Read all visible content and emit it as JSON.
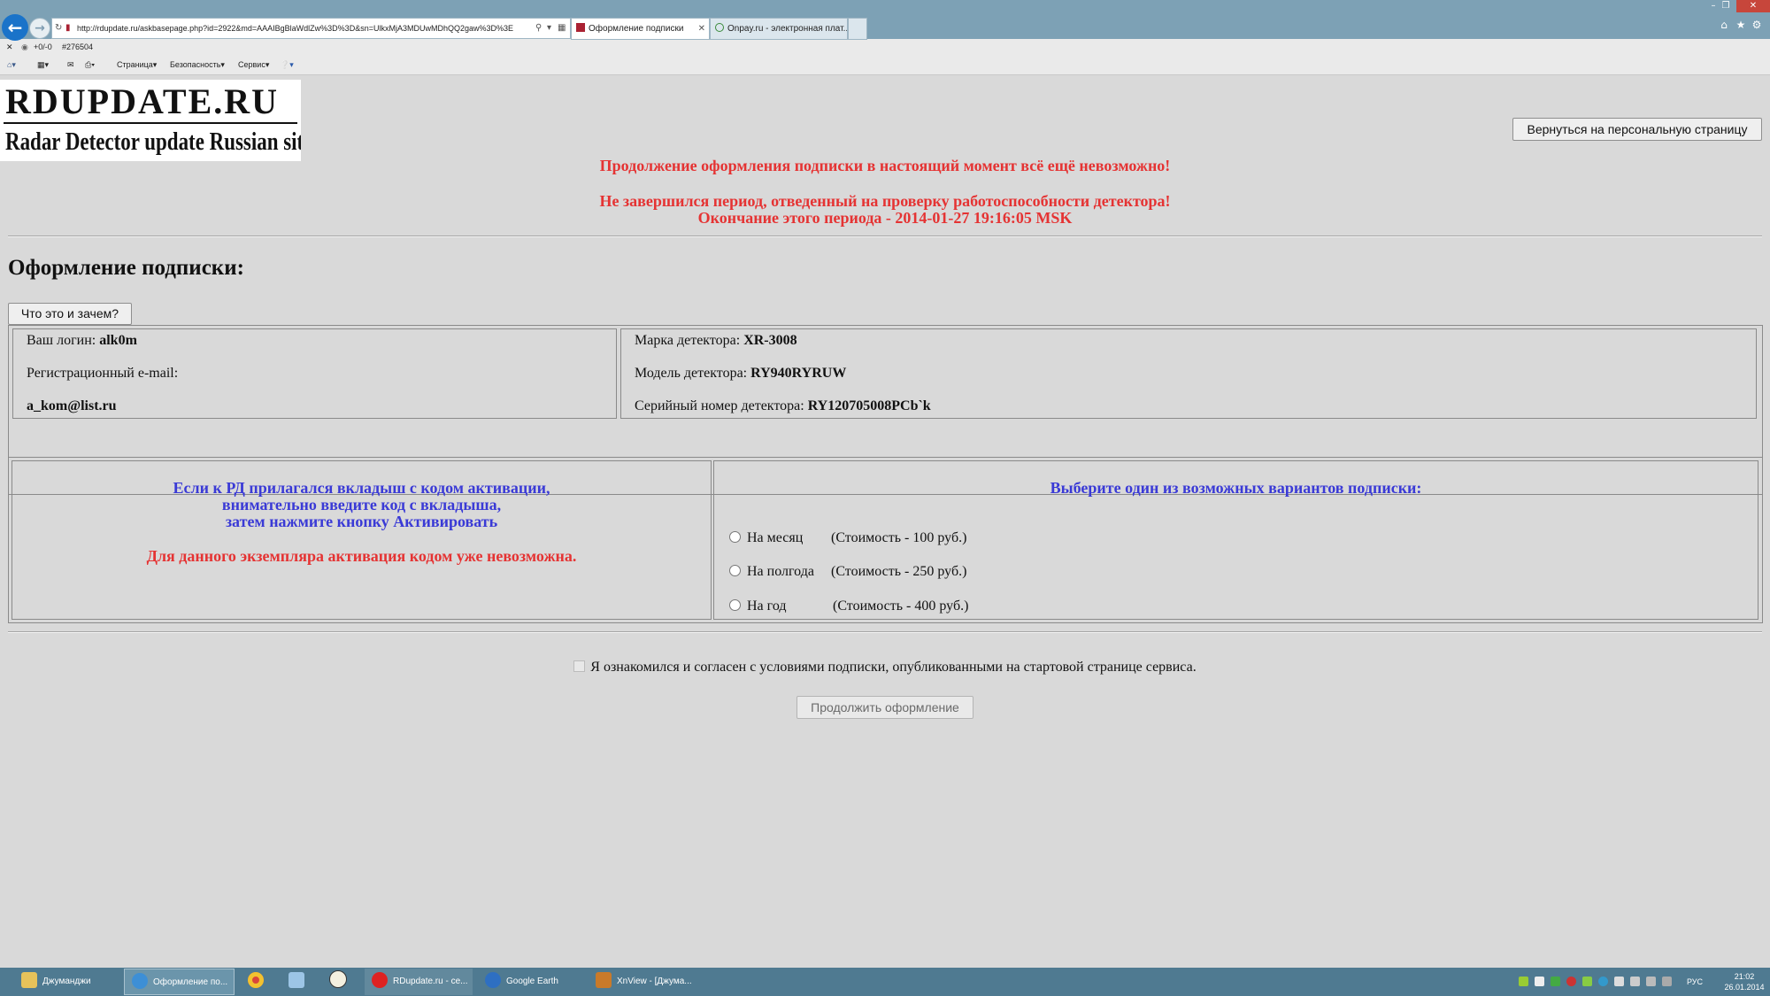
{
  "browser": {
    "address_url": "http://rdupdate.ru/askbasepage.php?id=2922&md=AAAIBgBlaWdlZw%3D%3D&sn=UlkxMjA3MDUwMDhQQ2gaw%3D%3E",
    "tabs": [
      {
        "label": "Оформление подписки",
        "active": true
      },
      {
        "label": "Onpay.ru - электронная плат...",
        "active": false
      }
    ],
    "status_text": "+0/-0",
    "status_id": "#276504",
    "command_bar": [
      "Страница",
      "Безопасность",
      "Сервис"
    ]
  },
  "logo": {
    "line1": "RDUPDATE.RU",
    "line2": "Radar Detector update Russian site"
  },
  "header": {
    "return_button": "Вернуться на персональную страницу",
    "warning1": "Продолжение оформления подписки в настоящий момент всё ещё невозможно!",
    "warning2": "Не завершился период, отведенный на проверку работоспособности детектора!",
    "warning3": "Окончание этого периода - 2014-01-27 19:16:05 MSK"
  },
  "main": {
    "title": "Оформление подписки:",
    "what_button": "Что это и зачем?",
    "user": {
      "login_label": "Ваш логин:",
      "login_value": "alk0m",
      "email_label": "Регистрационный e-mail:",
      "email_value": "a_kom@list.ru"
    },
    "detector": {
      "brand_label": "Марка детектора:",
      "brand_value": "XR-3008",
      "model_label": "Модель детектора:",
      "model_value": "RY940RYRUW",
      "serial_label": "Серийный номер детектора:",
      "serial_value": "RY120705008PCb`k"
    },
    "activation": {
      "line1": "Если к РД прилагался вкладыш с кодом активации,",
      "line2": "внимательно введите код с вкладыша,",
      "line3": "затем нажмите кнопку Активировать",
      "unavailable": "Для данного экземпляра активация кодом уже невозможна."
    },
    "subscription": {
      "heading": "Выберите один из возможных вариантов подписки:",
      "options": [
        {
          "name": "На месяц",
          "price": "(Стоимость - 100 руб.)"
        },
        {
          "name": "На полгода",
          "price": "(Стоимость - 250 руб.)"
        },
        {
          "name": "На год",
          "price": "(Стоимость - 400 руб.)"
        }
      ]
    },
    "agree_text": "Я ознакомился и согласен с условиями подписки, опубликованными на стартовой странице сервиса.",
    "continue_button": "Продолжить оформление"
  },
  "taskbar": {
    "items": [
      "Джуманджи",
      "Оформление по...",
      "RDupdate.ru - се...",
      "Google Earth",
      "XnView - [Джума..."
    ],
    "lang": "РУС",
    "time": "21:02",
    "date": "26.01.2014"
  }
}
